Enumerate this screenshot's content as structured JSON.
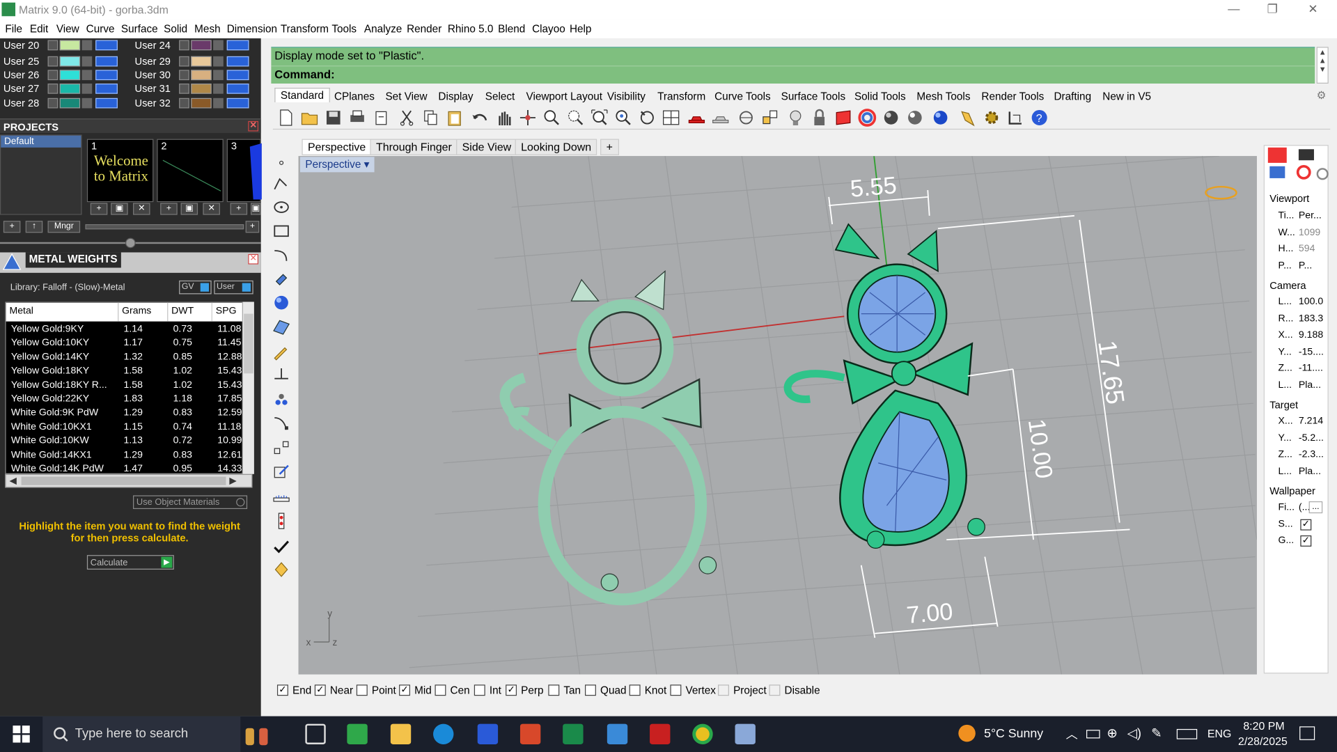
{
  "window": {
    "title": "Matrix 9.0 (64-bit) - gorba.3dm",
    "controls": [
      "—",
      "❐",
      "✕"
    ]
  },
  "menu": [
    "File",
    "Edit",
    "View",
    "Curve",
    "Surface",
    "Solid",
    "Mesh",
    "Dimension",
    "Transform",
    "Tools",
    "Analyze",
    "Render",
    "Rhino 5.0",
    "Blend",
    "Clayoo",
    "Help"
  ],
  "layers": [
    {
      "name": "User 20",
      "color": "#c7e8a0"
    },
    {
      "name": "User 24",
      "color": "#6a3a6a"
    },
    {
      "name": "User 25",
      "color": "#7fe8e8"
    },
    {
      "name": "User 29",
      "color": "#e8c89a"
    },
    {
      "name": "User 26",
      "color": "#2ee0d8"
    },
    {
      "name": "User 30",
      "color": "#d8b080"
    },
    {
      "name": "User 27",
      "color": "#1ab8a8"
    },
    {
      "name": "User 31",
      "color": "#b08848"
    },
    {
      "name": "User 28",
      "color": "#188878"
    },
    {
      "name": "User 32",
      "color": "#8a5a28"
    }
  ],
  "projects": {
    "title": "PROJECTS",
    "list": [
      "Default"
    ],
    "thumbs": [
      {
        "num": "1",
        "text": "Welcome to Matrix"
      },
      {
        "num": "2",
        "text": ""
      },
      {
        "num": "3",
        "text": ""
      }
    ],
    "mngr": "Mngr"
  },
  "metal": {
    "title": "METAL WEIGHTS",
    "library": "Library: Falloff - (Slow)-Metal",
    "gv": "GV",
    "user": "User",
    "columns": [
      "Metal",
      "Grams",
      "DWT",
      "SPG"
    ],
    "rows": [
      [
        "Yellow Gold:9KY",
        "1.14",
        "0.73",
        "11.08"
      ],
      [
        "Yellow Gold:10KY",
        "1.17",
        "0.75",
        "11.45"
      ],
      [
        "Yellow Gold:14KY",
        "1.32",
        "0.85",
        "12.88"
      ],
      [
        "Yellow Gold:18KY",
        "1.58",
        "1.02",
        "15.43"
      ],
      [
        "Yellow Gold:18KY R...",
        "1.58",
        "1.02",
        "15.43"
      ],
      [
        "Yellow Gold:22KY",
        "1.83",
        "1.18",
        "17.85"
      ],
      [
        "White Gold:9K PdW",
        "1.29",
        "0.83",
        "12.59"
      ],
      [
        "White Gold:10KX1",
        "1.15",
        "0.74",
        "11.18"
      ],
      [
        "White Gold:10KW",
        "1.13",
        "0.72",
        "10.99"
      ],
      [
        "White Gold:14KX1",
        "1.29",
        "0.83",
        "12.61"
      ],
      [
        "White Gold:14K PdW",
        "1.47",
        "0.95",
        "14.33"
      ]
    ],
    "use_object_materials": "Use Object Materials",
    "instruction": "Highlight the item you want to find the weight for then press calculate.",
    "calculate": "Calculate"
  },
  "command": {
    "history": "Display mode set to \"Plastic\".",
    "prompt": "Command:"
  },
  "tool_tabs": [
    "Standard",
    "CPlanes",
    "Set View",
    "Display",
    "Select",
    "Viewport Layout",
    "Visibility",
    "Transform",
    "Curve Tools",
    "Surface Tools",
    "Solid Tools",
    "Mesh Tools",
    "Render Tools",
    "Drafting",
    "New in V5"
  ],
  "viewport_tabs": [
    "Perspective",
    "Through Finger",
    "Side View",
    "Looking Down",
    "+"
  ],
  "viewport": {
    "label": "Perspective",
    "dims": {
      "top": "5.55",
      "height": "17.65",
      "inner": "10.00",
      "width": "7.00"
    },
    "axis": {
      "x": "x",
      "y": "y",
      "z": "z"
    }
  },
  "osnaps": [
    {
      "label": "End",
      "checked": true
    },
    {
      "label": "Near",
      "checked": true
    },
    {
      "label": "Point",
      "checked": false
    },
    {
      "label": "Mid",
      "checked": true
    },
    {
      "label": "Cen",
      "checked": false
    },
    {
      "label": "Int",
      "checked": false
    },
    {
      "label": "Perp",
      "checked": true
    },
    {
      "label": "Tan",
      "checked": false
    },
    {
      "label": "Quad",
      "checked": false
    },
    {
      "label": "Knot",
      "checked": false
    },
    {
      "label": "Vertex",
      "checked": false
    },
    {
      "label": "Project",
      "checked": false
    },
    {
      "label": "Disable",
      "checked": false
    }
  ],
  "properties": {
    "viewport_title": "Viewport",
    "viewport_rows": [
      [
        "Ti...",
        "Per..."
      ],
      [
        "W...",
        "1099"
      ],
      [
        "H...",
        "594"
      ],
      [
        "P...",
        "P..."
      ]
    ],
    "camera_title": "Camera",
    "camera_rows": [
      [
        "L...",
        "100.0"
      ],
      [
        "R...",
        "183.3"
      ],
      [
        "X...",
        "9.188"
      ],
      [
        "Y...",
        "-15...."
      ],
      [
        "Z...",
        "-11...."
      ],
      [
        "L...",
        "Pla..."
      ]
    ],
    "target_title": "Target",
    "target_rows": [
      [
        "X...",
        "7.214"
      ],
      [
        "Y...",
        "-5.2..."
      ],
      [
        "Z...",
        "-2.3..."
      ],
      [
        "L...",
        "Pla..."
      ]
    ],
    "wallpaper_title": "Wallpaper",
    "wallpaper_rows": [
      [
        "Fi...",
        "(..."
      ],
      [
        "S...",
        ""
      ],
      [
        "G...",
        ""
      ]
    ],
    "wallpaper_btn": "..."
  },
  "taskbar": {
    "search_placeholder": "Type here to search",
    "weather": "5°C  Sunny",
    "lang": "ENG",
    "time": "8:20 PM",
    "date": "2/28/2025"
  }
}
